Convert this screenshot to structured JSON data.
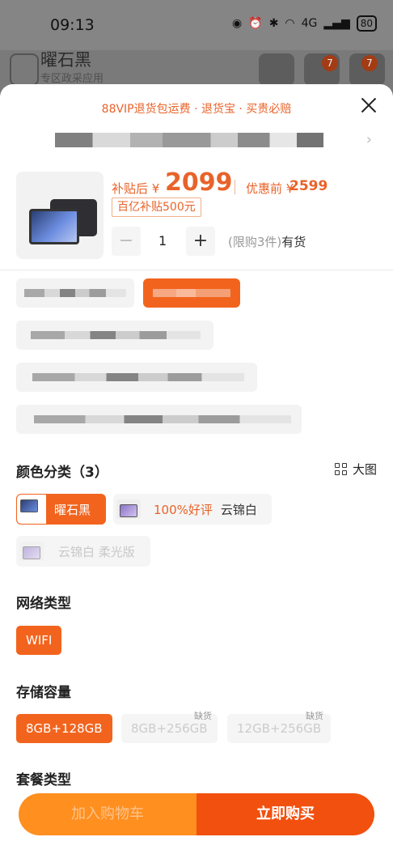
{
  "status_bar": {
    "time": "09:13",
    "signal": "4G",
    "battery": "80"
  },
  "background_header": {
    "title": "曜石黑",
    "subtitle": "专区政采应用",
    "cart_badge": "7",
    "more_badge": "7"
  },
  "sheet": {
    "promo": "88VIP退货包运费 · 退货宝 · 买贵必赔",
    "price": {
      "label": "补贴后 ¥",
      "value": "2099",
      "original_label": "优惠前 ¥",
      "original_value": "2599",
      "subsidy_tag": "百亿补贴500元"
    },
    "quantity": {
      "minus": "−",
      "value": "1",
      "plus": "+",
      "limit": "(限购3件)",
      "stock": "有货"
    },
    "colors": {
      "title": "颜色分类（3）",
      "big_picture_label": "大图",
      "options": [
        {
          "label": "曜石黑",
          "selected": true
        },
        {
          "label_badge": "100%好评",
          "label": "云锦白",
          "selected": false
        },
        {
          "label": "云锦白 柔光版",
          "disabled": true
        }
      ]
    },
    "network": {
      "title": "网络类型",
      "options": [
        {
          "label": "WIFI",
          "selected": true
        }
      ]
    },
    "storage": {
      "title": "存储容量",
      "options": [
        {
          "label": "8GB+128GB",
          "selected": true
        },
        {
          "label": "8GB+256GB",
          "tag": "缺货",
          "disabled": true
        },
        {
          "label": "12GB+256GB",
          "tag": "缺货",
          "disabled": true
        }
      ]
    },
    "package": {
      "title": "套餐类型"
    }
  },
  "actions": {
    "add_to_cart": "加入购物车",
    "buy_now": "立即购买"
  },
  "colors": {
    "accent": "#f2641e",
    "cart": "#ff8f1f",
    "buy": "#f2500f",
    "price": "#e8632a"
  }
}
